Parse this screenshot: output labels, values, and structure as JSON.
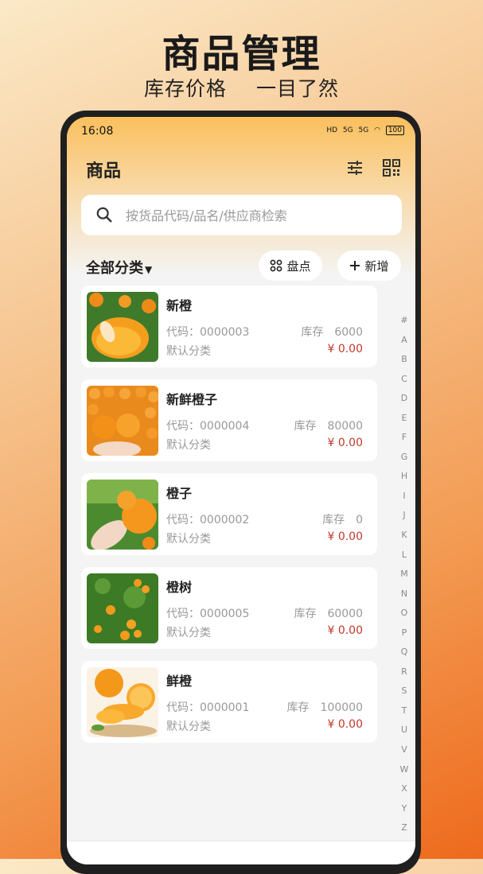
{
  "promo": {
    "title": "商品管理",
    "subtitle": "库存价格 一目了然"
  },
  "status": {
    "time": "16:08",
    "signal": "5G",
    "hd": "HD",
    "battery": "100"
  },
  "appbar": {
    "title": "商品"
  },
  "search": {
    "placeholder": "按货品代码/品名/供应商检索",
    "value": ""
  },
  "filter": {
    "category": "全部分类"
  },
  "actions": {
    "inventory": "盘点",
    "add": "新增"
  },
  "labels": {
    "code_prefix": "代码：",
    "stock": "库存"
  },
  "products": [
    {
      "name": "新橙",
      "code": "0000003",
      "stock": "6000",
      "category": "默认分类",
      "price": "¥ 0.00"
    },
    {
      "name": "新鲜橙子",
      "code": "0000004",
      "stock": "80000",
      "category": "默认分类",
      "price": "¥ 0.00"
    },
    {
      "name": "橙子",
      "code": "0000002",
      "stock": "0",
      "category": "默认分类",
      "price": "¥ 0.00"
    },
    {
      "name": "橙树",
      "code": "0000005",
      "stock": "60000",
      "category": "默认分类",
      "price": "¥ 0.00"
    },
    {
      "name": "鲜橙",
      "code": "0000001",
      "stock": "100000",
      "category": "默认分类",
      "price": "¥ 0.00"
    }
  ],
  "index_letters": [
    "#",
    "A",
    "B",
    "C",
    "D",
    "E",
    "F",
    "G",
    "H",
    "I",
    "J",
    "K",
    "L",
    "M",
    "N",
    "O",
    "P",
    "Q",
    "R",
    "S",
    "T",
    "U",
    "V",
    "W",
    "X",
    "Y",
    "Z"
  ],
  "colors": {
    "accent": "#fbbf5d",
    "price": "#c0392b",
    "muted": "#999999"
  }
}
